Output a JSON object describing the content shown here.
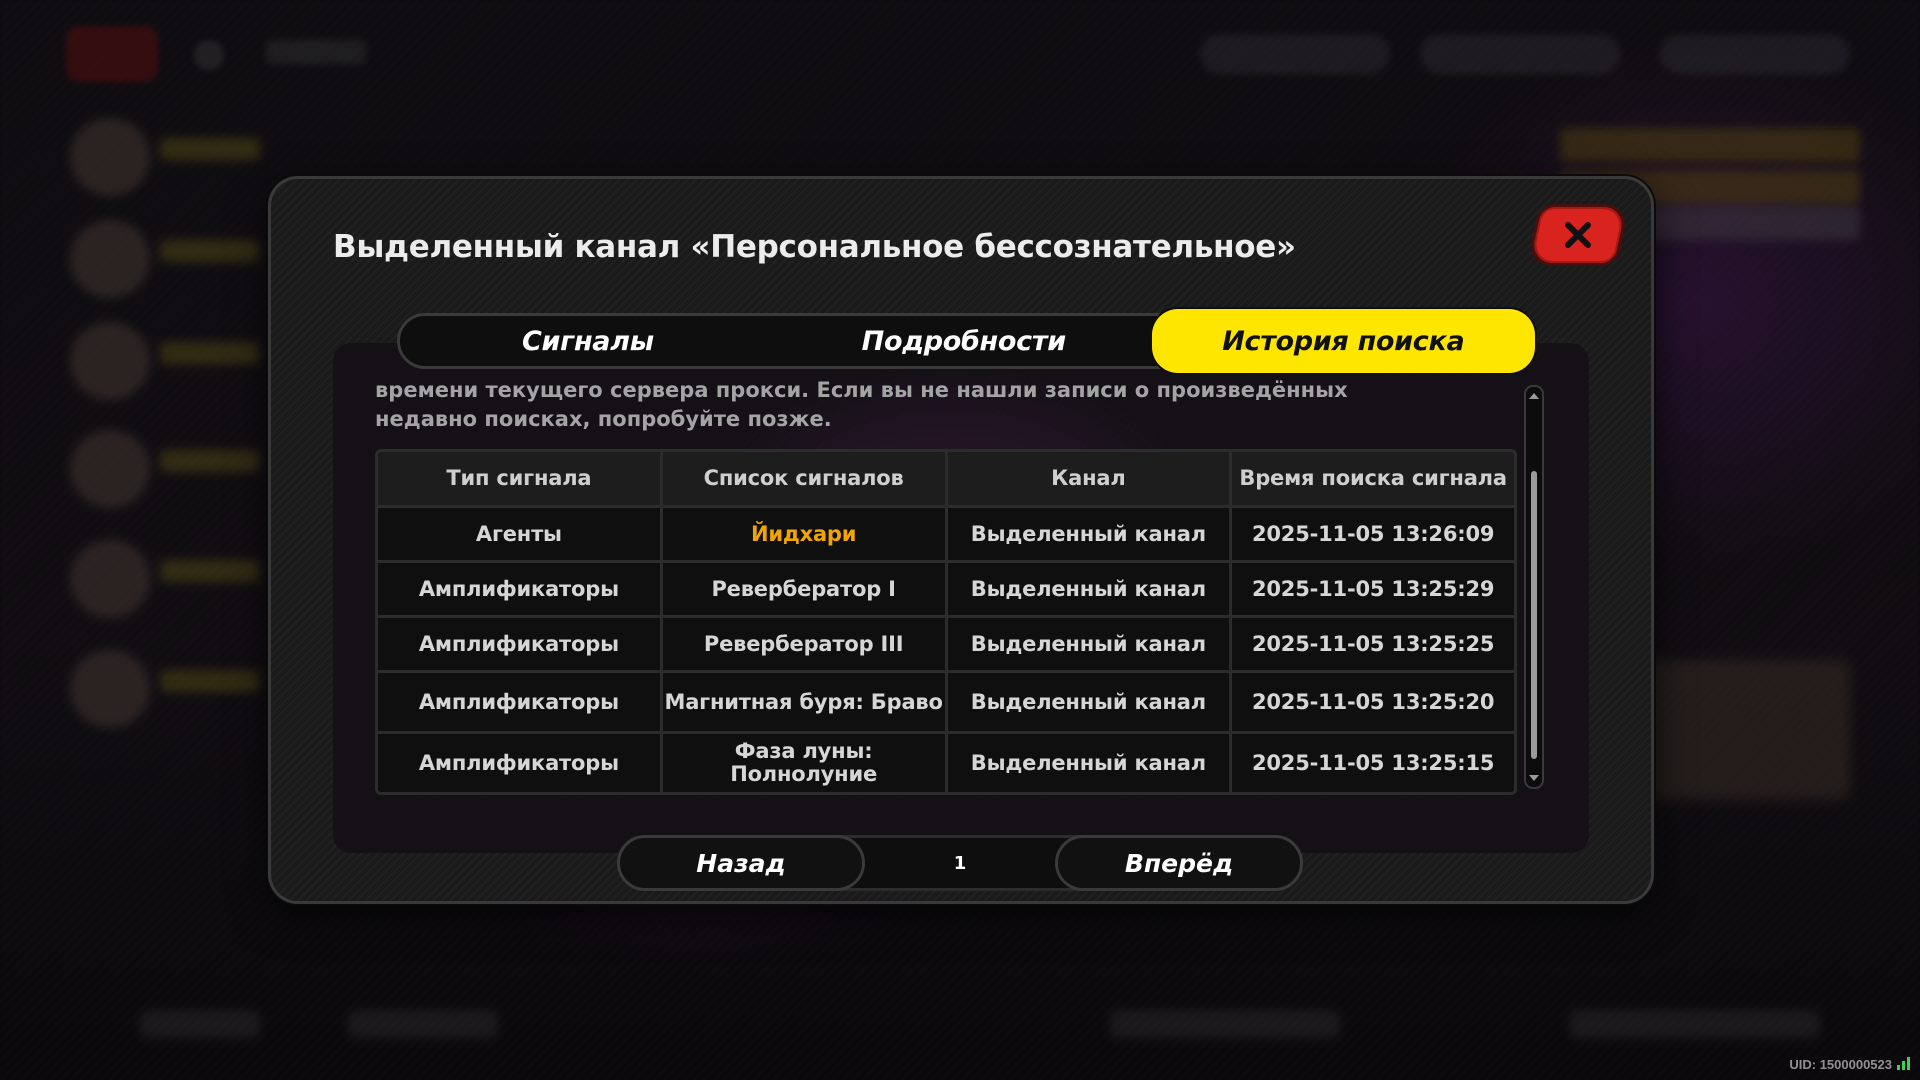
{
  "modal": {
    "title": "Выделенный канал «Персональное бессознательное»",
    "close_icon": "close-x-icon"
  },
  "tabs": [
    {
      "label": "Сигналы",
      "active": false
    },
    {
      "label": "Подробности",
      "active": false
    },
    {
      "label": "История поиска",
      "active": true
    }
  ],
  "description": "времени текущего сервера прокси. Если вы не нашли записи о произведённых недавно поисках, попробуйте позже.",
  "table": {
    "headers": [
      "Тип сигнала",
      "Список сигналов",
      "Канал",
      "Время поиска сигнала"
    ],
    "rows": [
      [
        "Агенты",
        "Йидхари",
        "Выделенный канал",
        "2025-11-05 13:26:09"
      ],
      [
        "Амплификаторы",
        "Ревербератор I",
        "Выделенный канал",
        "2025-11-05 13:25:29"
      ],
      [
        "Амплификаторы",
        "Ревербератор III",
        "Выделенный канал",
        "2025-11-05 13:25:25"
      ],
      [
        "Амплификаторы",
        "Магнитная буря: Браво",
        "Выделенный канал",
        "2025-11-05 13:25:20"
      ],
      [
        "Амплификаторы",
        "Фаза луны: Полнолуние",
        "Выделенный канал",
        "2025-11-05 13:25:15"
      ]
    ],
    "highlight_color": "#f2a400"
  },
  "pagination": {
    "prev_label": "Назад",
    "page": "1",
    "next_label": "Вперёд"
  },
  "footer": {
    "uid": "UID: 1500000523"
  },
  "colors": {
    "accent_yellow": "#ffe600",
    "close_red": "#d8231e"
  }
}
